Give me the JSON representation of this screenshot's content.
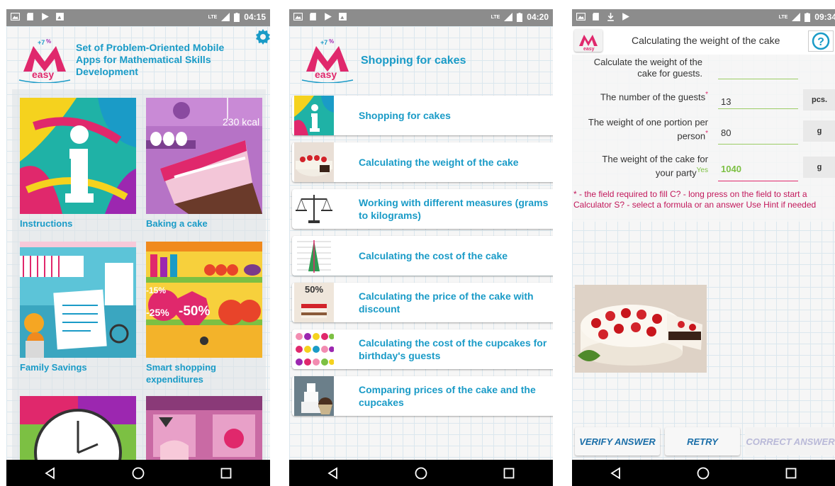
{
  "status": {
    "screen1_time": "04:15",
    "screen2_time": "04:20",
    "screen3_time": "09:34",
    "carrier": "LTE"
  },
  "logo_text": "easy",
  "screen1": {
    "title": "Set of Problem-Oriented Mobile Apps for Mathematical Skills Development",
    "settings_icon": "gear-icon",
    "tiles": [
      {
        "label": "Instructions"
      },
      {
        "label": "Baking a cake",
        "badge": "230 kcal"
      },
      {
        "label": "Family Savings"
      },
      {
        "label": "Smart shopping expenditures",
        "badges": [
          "-15%",
          "-25%",
          "-50%"
        ]
      }
    ]
  },
  "screen2": {
    "title": "Shopping for cakes",
    "items": [
      {
        "label": "Shopping for cakes"
      },
      {
        "label": "Calculating  the  weight of the cake"
      },
      {
        "label": "Working with different measures (grams to kilograms)"
      },
      {
        "label": "Calculating the cost of the cake"
      },
      {
        "label": "Calculating the price of the cake with discount",
        "badge": "50%"
      },
      {
        "label": "Calculating the cost of the cupcakes for birthday's guests"
      },
      {
        "label": "Comparing prices of the cake and the cupcakes"
      }
    ]
  },
  "screen3": {
    "title": "Calculating  the  weight of the cake",
    "help_icon": "help-icon",
    "question": "Calculate the weight of the cake for guests.",
    "fields": [
      {
        "label": "The number of the guests",
        "required": "*",
        "value": "13",
        "unit": "pcs."
      },
      {
        "label": "The weight of one portion per person",
        "required": "*",
        "value": "80",
        "unit": "g"
      },
      {
        "label": "The  weight of the cake for your party",
        "tag": "Yes",
        "value": "1040",
        "unit": "g"
      }
    ],
    "hint": "* - the field required to fill C? - long press on the field to start a Calculator S? - select a formula or an answer Use Hint if needed",
    "buttons": {
      "verify": "VERIFY ANSWER",
      "retry": "RETRY",
      "correct": "CORRECT ANSWER"
    }
  }
}
